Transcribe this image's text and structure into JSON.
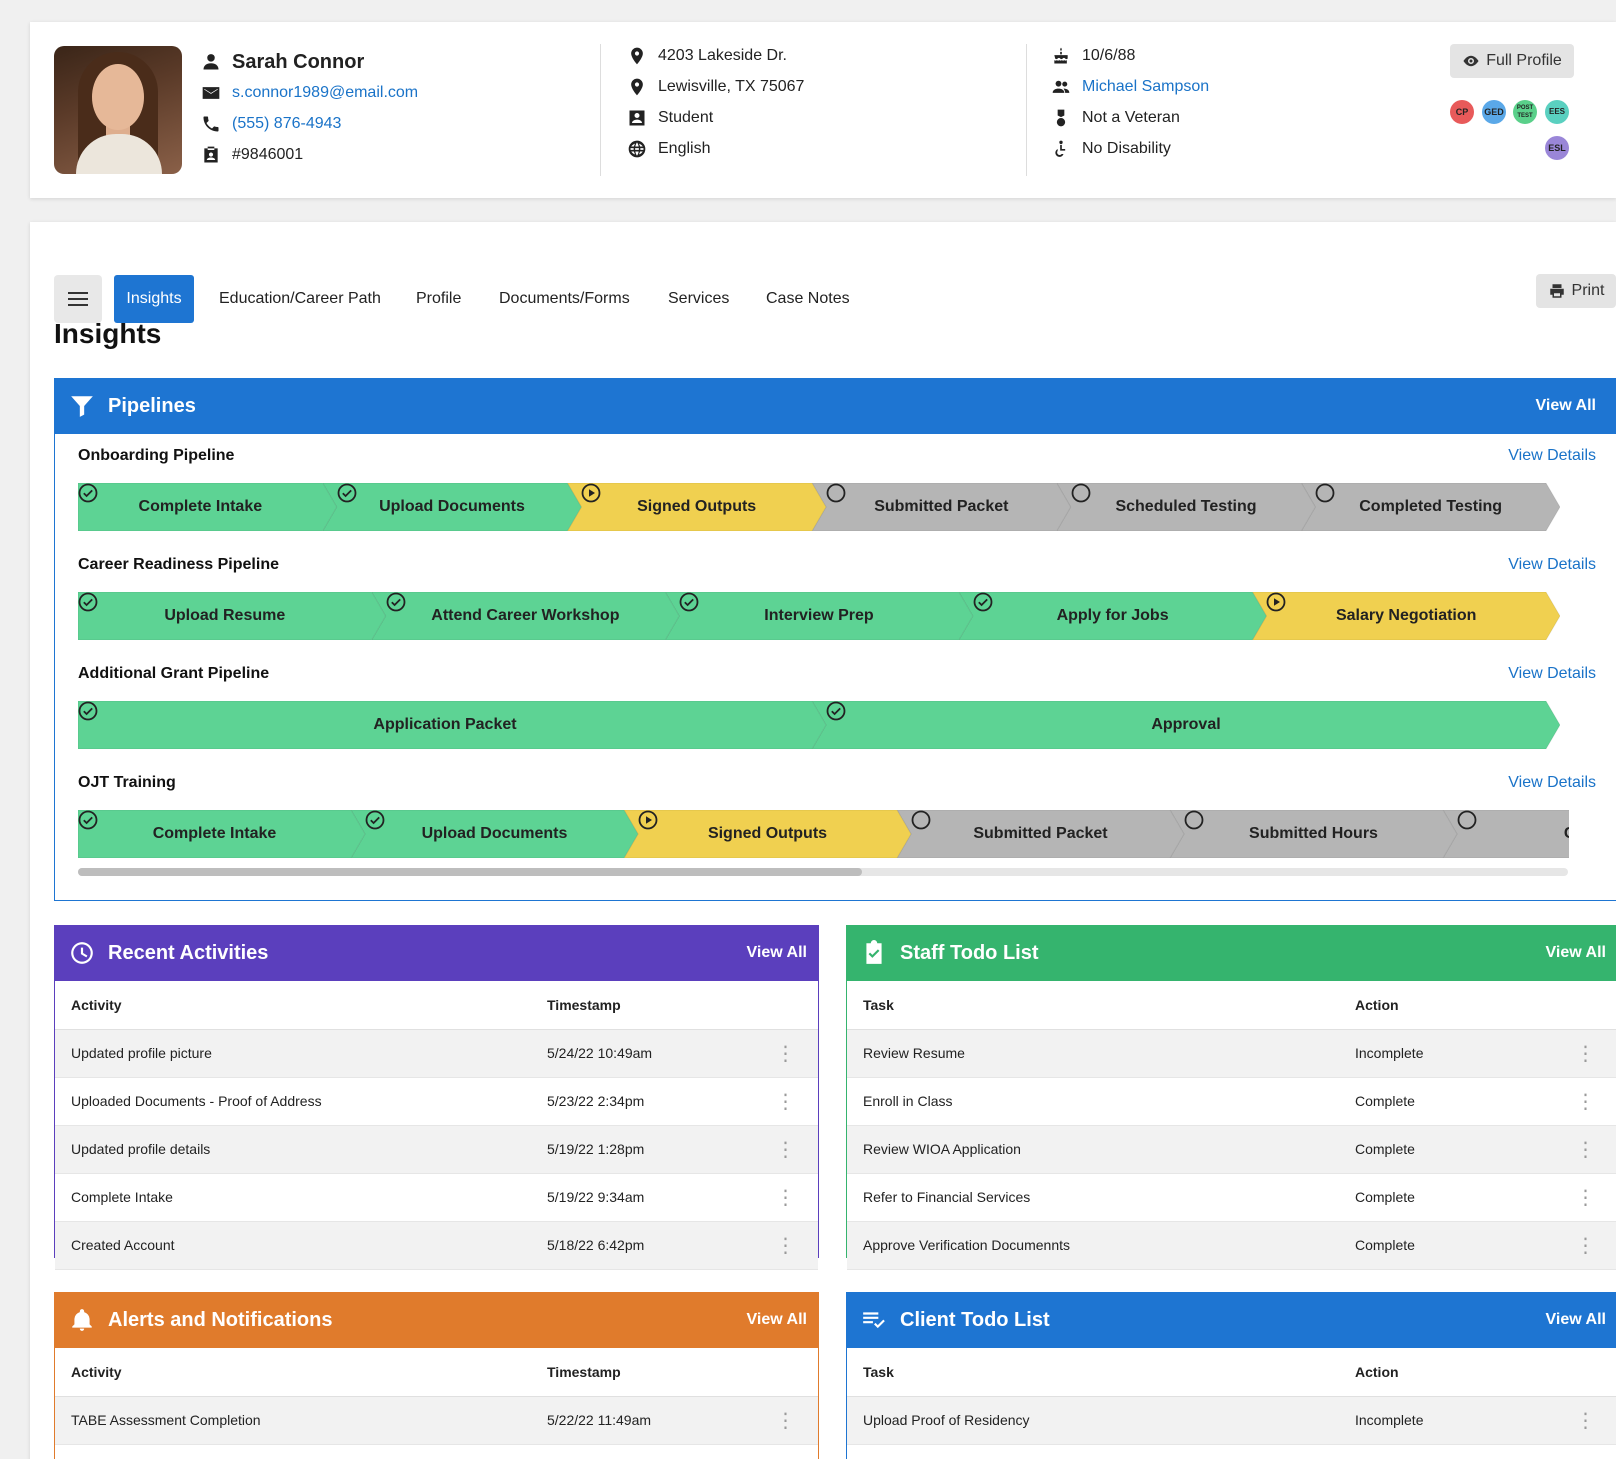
{
  "client": {
    "name": "Sarah Connor",
    "email": "s.connor1989@email.com",
    "phone": "(555) 876-4943",
    "id": "#9846001",
    "address1": "4203 Lakeside Dr.",
    "address2": "Lewisville, TX 75067",
    "status": "Student",
    "language": "English",
    "dob": "10/6/88",
    "case_manager": "Michael Sampson",
    "veteran": "Not a Veteran",
    "disability": "No Disability"
  },
  "header": {
    "full_profile_label": "Full Profile",
    "badges": [
      {
        "text": "CP",
        "color": "#e85a5a"
      },
      {
        "text": "GED",
        "color": "#5aa8e8"
      },
      {
        "text": "POST TEST",
        "color": "#5ad08a"
      },
      {
        "text": "EES",
        "color": "#5ad0c0"
      },
      {
        "text": "ESL",
        "color": "#9a86d8"
      }
    ]
  },
  "nav": {
    "tabs": [
      "Insights",
      "Education/Career Path",
      "Profile",
      "Documents/Forms",
      "Services",
      "Case Notes"
    ],
    "print_label": "Print"
  },
  "page_title": "Insights",
  "pipelines": {
    "title": "Pipelines",
    "view_all": "View All",
    "view_details": "View Details",
    "items": [
      {
        "name": "Onboarding Pipeline",
        "steps": [
          {
            "label": "Complete Intake",
            "status": "done"
          },
          {
            "label": "Upload Documents",
            "status": "done"
          },
          {
            "label": "Signed Outputs",
            "status": "active"
          },
          {
            "label": "Submitted Packet",
            "status": "todo"
          },
          {
            "label": "Scheduled Testing",
            "status": "todo"
          },
          {
            "label": "Completed Testing",
            "status": "todo"
          }
        ]
      },
      {
        "name": "Career Readiness Pipeline",
        "steps": [
          {
            "label": "Upload Resume",
            "status": "done"
          },
          {
            "label": "Attend Career Workshop",
            "status": "done"
          },
          {
            "label": "Interview Prep",
            "status": "done"
          },
          {
            "label": "Apply for Jobs",
            "status": "done"
          },
          {
            "label": "Salary Negotiation",
            "status": "active"
          }
        ]
      },
      {
        "name": "Additional Grant Pipeline",
        "steps": [
          {
            "label": "Application Packet",
            "status": "done"
          },
          {
            "label": "Approval",
            "status": "done"
          }
        ]
      },
      {
        "name": "OJT Training",
        "steps": [
          {
            "label": "Complete Intake",
            "status": "done"
          },
          {
            "label": "Upload Documents",
            "status": "done"
          },
          {
            "label": "Signed Outputs",
            "status": "active"
          },
          {
            "label": "Submitted Packet",
            "status": "todo"
          },
          {
            "label": "Submitted Hours",
            "status": "todo"
          },
          {
            "label": "Comp",
            "status": "todo"
          }
        ]
      }
    ]
  },
  "recent_activities": {
    "title": "Recent Activities",
    "view_all": "View All",
    "columns": [
      "Activity",
      "Timestamp"
    ],
    "rows": [
      [
        "Updated profile picture",
        "5/24/22  10:49am"
      ],
      [
        "Uploaded Documents - Proof of Address",
        "5/23/22  2:34pm"
      ],
      [
        "Updated profile details",
        "5/19/22  1:28pm"
      ],
      [
        "Complete Intake",
        "5/19/22  9:34am"
      ],
      [
        "Created Account",
        "5/18/22  6:42pm"
      ]
    ]
  },
  "staff_todo": {
    "title": "Staff Todo List",
    "view_all": "View All",
    "columns": [
      "Task",
      "Action"
    ],
    "rows": [
      [
        "Review Resume",
        "Incomplete"
      ],
      [
        "Enroll in Class",
        "Complete"
      ],
      [
        "Review WIOA Application",
        "Complete"
      ],
      [
        "Refer to Financial Services",
        "Complete"
      ],
      [
        "Approve Verification Documennts",
        "Complete"
      ]
    ]
  },
  "alerts": {
    "title": "Alerts and Notifications",
    "view_all": "View All",
    "columns": [
      "Activity",
      "Timestamp"
    ],
    "rows": [
      [
        "TABE Assessment Completion",
        "5/22/22  11:49am"
      ]
    ]
  },
  "client_todo": {
    "title": "Client Todo List",
    "view_all": "View All",
    "columns": [
      "Task",
      "Action"
    ],
    "rows": [
      [
        "Upload Proof of Residency",
        "Incomplete"
      ]
    ]
  },
  "colors": {
    "blue": "#1e75d2",
    "purple": "#5b3fbd",
    "green_header": "#35b46e",
    "orange": "#e07b2c",
    "step_done": "#5dd394",
    "step_active": "#f0d050",
    "step_todo": "#b5b5b5"
  }
}
